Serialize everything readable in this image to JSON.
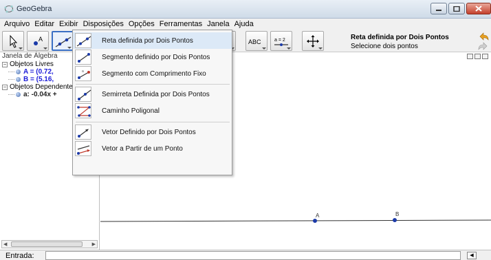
{
  "window": {
    "title": "GeoGebra",
    "icon": "geogebra-logo-icon"
  },
  "menu": [
    "Arquivo",
    "Editar",
    "Exibir",
    "Disposições",
    "Opções",
    "Ferramentas",
    "Janela",
    "Ajuda"
  ],
  "toolbar": {
    "tools": [
      {
        "name": "move-tool-icon"
      },
      {
        "name": "new-point-tool-icon"
      },
      {
        "name": "line-through-two-points-tool-icon"
      },
      {
        "name": "perpendicular-line-tool-icon"
      },
      {
        "name": "polygon-tool-icon"
      },
      {
        "name": "circle-with-center-tool-icon"
      },
      {
        "name": "ellipse-tool-icon"
      },
      {
        "name": "angle-tool-icon"
      },
      {
        "name": "reflect-about-line-tool-icon"
      },
      {
        "name": "insert-text-tool-icon",
        "text": "ABC"
      },
      {
        "name": "slider-tool-icon",
        "text": "a = 2"
      },
      {
        "name": "move-graphics-view-tool-icon"
      }
    ],
    "description_title": "Reta definida por Dois Pontos",
    "description_hint": "Selecione dois pontos"
  },
  "algebra": {
    "title": "Janela de Álgebra",
    "free_header": "Objetos Livres",
    "free_items": [
      "A = (0.72,",
      "B = (5.16,"
    ],
    "dependent_header": "Objetos Dependentes",
    "dependent_items": [
      "a: -0.04x +"
    ]
  },
  "dropdown": {
    "items": [
      {
        "label": "Reta definida por Dois Pontos",
        "icon": "line-through-two-points-icon"
      },
      {
        "label": "Segmento definido por Dois Pontos",
        "icon": "segment-two-points-icon"
      },
      {
        "label": "Segmento com Comprimento Fixo",
        "icon": "segment-fixed-length-icon"
      },
      {
        "label": "Semirreta Definida por Dois Pontos",
        "icon": "ray-two-points-icon"
      },
      {
        "label": "Caminho Poligonal",
        "icon": "polyline-icon"
      },
      {
        "label": "Vetor Definido por Dois Pontos",
        "icon": "vector-two-points-icon"
      },
      {
        "label": "Vetor a Partir de um Ponto",
        "icon": "vector-from-point-icon"
      }
    ]
  },
  "graphics": {
    "points": [
      {
        "label": "A"
      },
      {
        "label": "B"
      }
    ]
  },
  "input_bar": {
    "label": "Entrada:",
    "value": ""
  },
  "colors": {
    "point_fill": "#1b3aa8",
    "line": "#333333",
    "highlight": "#dce9f7",
    "selected_tool_border": "#3a6fc4"
  }
}
